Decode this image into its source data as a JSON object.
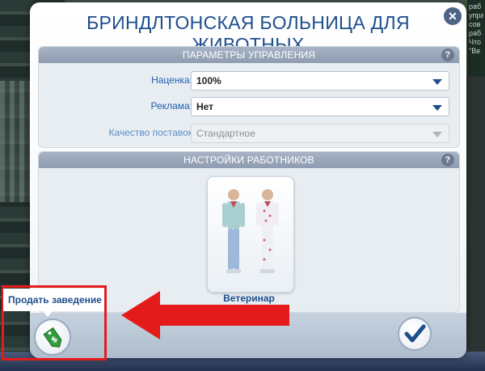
{
  "dialog": {
    "title": "Бриндлтонская больница для животных",
    "close_icon": "close-icon"
  },
  "management": {
    "header": "Параметры управления",
    "help": "?",
    "markup_label": "Наценка:",
    "markup_value": "100%",
    "ads_label": "Реклама:",
    "ads_value": "Нет",
    "supply_label": "Качество поставок",
    "supply_value": "Стандартное"
  },
  "staff": {
    "header": "Настройки работников",
    "help": "?",
    "role_label": "Ветеринар"
  },
  "actions": {
    "sell_tooltip": "Продать заведение",
    "sell_icon": "price-tag-dollar-icon",
    "confirm_icon": "checkmark-icon"
  },
  "side_panel": {
    "lines": [
      "раб",
      "упра",
      "сов",
      "раб",
      "Что",
      "\"Ве"
    ]
  },
  "colors": {
    "accent": "#1e4e8c",
    "highlight": "#e31b1b",
    "sell_green": "#2e9b3d"
  }
}
